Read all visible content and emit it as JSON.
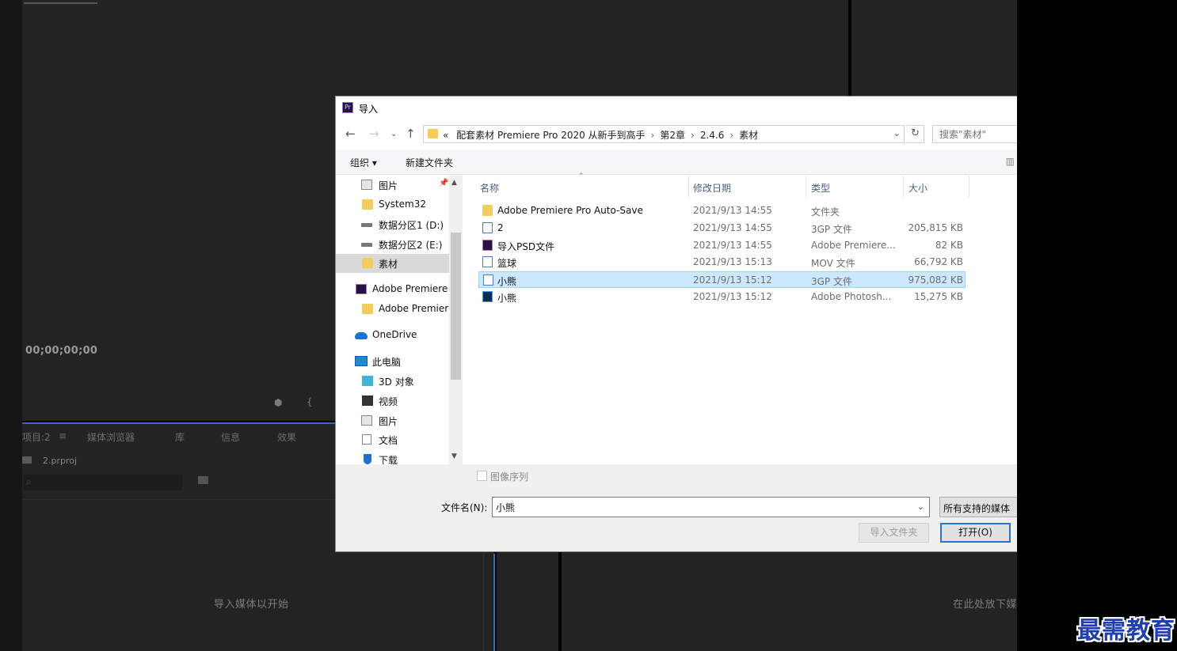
{
  "background": {
    "timecode": "00;00;00;00",
    "project_tabs": [
      "项目:2",
      "媒体浏览器",
      "库",
      "信息",
      "效果"
    ],
    "project_file": "2.prproj",
    "project_empty_hint": "导入媒体以开始",
    "timeline_empty_hint": "在此处放下媒"
  },
  "watermark": "最需教育",
  "dialog": {
    "title": "导入",
    "title_badge": "Pr",
    "address": {
      "overflow": "«",
      "crumbs": [
        "配套素材 Premiere Pro 2020 从新手到高手",
        "第2章",
        "2.4.6",
        "素材"
      ]
    },
    "search_placeholder": "搜索\"素材\"",
    "toolbar": {
      "organize": "组织 ▾",
      "new_folder": "新建文件夹"
    },
    "nav_items": [
      {
        "label": "图片",
        "icon": "pictures-icon"
      },
      {
        "label": "System32",
        "icon": "folder-icon"
      },
      {
        "label": "数据分区1 (D:)",
        "icon": "drive-icon"
      },
      {
        "label": "数据分区2 (E:)",
        "icon": "drive-icon"
      },
      {
        "label": "素材",
        "icon": "folder-icon",
        "selected": true
      },
      {
        "label": "Adobe Premiere",
        "icon": "premiere-icon"
      },
      {
        "label": "Adobe Premier",
        "icon": "folder-icon"
      },
      {
        "label": "OneDrive",
        "icon": "onedrive-icon"
      },
      {
        "label": "此电脑",
        "icon": "this-pc-icon"
      },
      {
        "label": "3D 对象",
        "icon": "3d-objects-icon"
      },
      {
        "label": "视频",
        "icon": "videos-icon"
      },
      {
        "label": "图片",
        "icon": "pictures-icon"
      },
      {
        "label": "文档",
        "icon": "documents-icon"
      },
      {
        "label": "下载",
        "icon": "downloads-icon"
      }
    ],
    "columns": {
      "name": "名称",
      "modified": "修改日期",
      "type": "类型",
      "size": "大小"
    },
    "files": [
      {
        "name": "Adobe Premiere Pro Auto-Save",
        "modified": "2021/9/13 14:55",
        "type": "文件夹",
        "size": "",
        "icon": "folder-icon"
      },
      {
        "name": "2",
        "modified": "2021/9/13 14:55",
        "type": "3GP 文件",
        "size": "205,815 KB",
        "icon": "file-icon"
      },
      {
        "name": "导入PSD文件",
        "modified": "2021/9/13 14:55",
        "type": "Adobe Premiere...",
        "size": "82 KB",
        "icon": "premiere-project-icon"
      },
      {
        "name": "篮球",
        "modified": "2021/9/13 15:13",
        "type": "MOV 文件",
        "size": "66,792 KB",
        "icon": "file-icon"
      },
      {
        "name": "小熊",
        "modified": "2021/9/13 15:12",
        "type": "3GP 文件",
        "size": "975,082 KB",
        "icon": "file-icon",
        "selected": true
      },
      {
        "name": "小熊",
        "modified": "2021/9/13 15:12",
        "type": "Adobe Photosh...",
        "size": "15,275 KB",
        "icon": "photoshop-file-icon"
      }
    ],
    "image_sequence_label": "图像序列",
    "filename_label": "文件名(N):",
    "filename_value": "小熊",
    "filter_label": "所有支持的媒体",
    "import_folder_label": "导入文件夹",
    "open_label": "打开(O)"
  }
}
